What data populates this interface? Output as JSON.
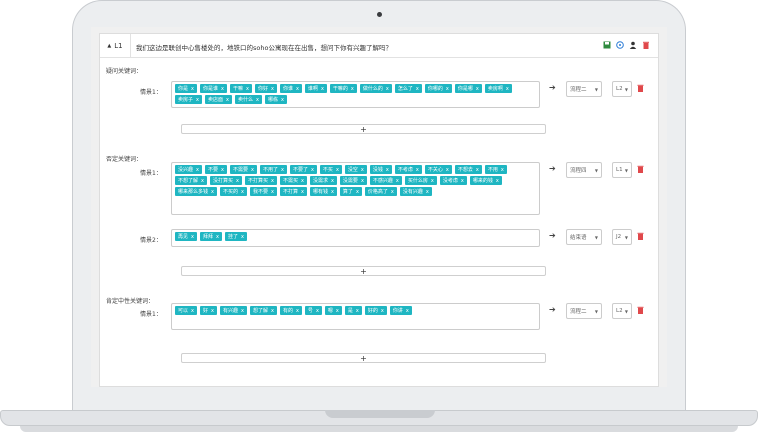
{
  "panel": {
    "collapse_icon": "caret-up-icon",
    "id_label": "L1",
    "question": "我们这边是联创中心售楼处的，地铁口的soho公寓现在在出售，想问下你有兴趣了解吗？",
    "icons": [
      "save-icon",
      "info-icon",
      "user-icon",
      "trash-icon"
    ]
  },
  "sections": [
    {
      "title": "疑问关键词：",
      "rows": [
        {
          "label": "情景1：",
          "tags": [
            "你是",
            "你是谁",
            "干嘛",
            "你好",
            "你谁",
            "谁啊",
            "干嘛的",
            "做什么的",
            "怎么了",
            "你哪的",
            "你是哪",
            "卖房啊",
            "卖房子",
            "卖店面",
            "卖什么",
            "哪栋"
          ],
          "flow": "流程二",
          "level": "L2"
        }
      ]
    },
    {
      "title": "否定关键词：",
      "rows": [
        {
          "label": "情景1：",
          "tags": [
            "没兴趣",
            "不要",
            "不需要",
            "不用了",
            "不要了",
            "不买",
            "没空",
            "没钱",
            "不考虑",
            "不关心",
            "不想去",
            "不用",
            "不想了解",
            "没打算买",
            "不打算买",
            "不需买",
            "没需求",
            "没需要",
            "不感兴趣",
            "买什么房",
            "没考虑",
            "哪来的钱",
            "哪来那么多钱",
            "不买的",
            "我不要",
            "不打算",
            "哪有钱",
            "算了",
            "价格高了",
            "没有兴趣"
          ],
          "flow": "流程四",
          "level": "L1"
        },
        {
          "label": "情景2：",
          "tags": [
            "再见",
            "拜拜",
            "挂了"
          ],
          "flow": "结束语",
          "level": "J2"
        }
      ]
    },
    {
      "title": "肯定中性关键词：",
      "rows": [
        {
          "label": "情景1：",
          "tags": [
            "可以",
            "好",
            "有兴趣",
            "想了解",
            "有的",
            "号",
            "嗯",
            "是",
            "好的",
            "你讲"
          ],
          "flow": "流程二",
          "level": "L2"
        }
      ]
    }
  ],
  "tag_remove_glyph": "x",
  "add_glyph": "+",
  "arrow_glyph": "➔",
  "caret_glyph": "▼",
  "colors": {
    "tag": "#1fb6c2",
    "delete": "#e0484b",
    "save": "#2e8b3e",
    "info": "#2a7bd6"
  }
}
